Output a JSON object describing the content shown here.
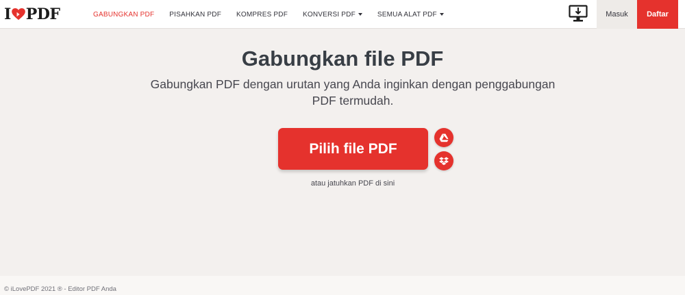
{
  "header": {
    "logo": {
      "prefix": "I",
      "suffix": "PDF",
      "heart_color": "#e5322d"
    },
    "nav": [
      {
        "label": "GABUNGKAN PDF",
        "active": true
      },
      {
        "label": "PISAHKAN PDF",
        "active": false
      },
      {
        "label": "KOMPRES PDF",
        "active": false
      },
      {
        "label": "KONVERSI PDF",
        "active": false,
        "dropdown": true
      },
      {
        "label": "SEMUA ALAT PDF",
        "active": false,
        "dropdown": true
      }
    ],
    "desktop_icon": "desktop-download-icon",
    "login_label": "Masuk",
    "signup_label": "Daftar"
  },
  "main": {
    "title": "Gabungkan file PDF",
    "subtitle": "Gabungkan PDF dengan urutan yang Anda inginkan dengan penggabungan PDF termudah.",
    "select_button": "Pilih file PDF",
    "cloud_buttons": [
      "google-drive-icon",
      "dropbox-icon"
    ],
    "drop_hint": "atau jatuhkan PDF di sini"
  },
  "footer": {
    "text": "© iLovePDF 2021 ® - Editor PDF Anda"
  },
  "colors": {
    "accent": "#e5322d",
    "background": "#f3f0ee",
    "text_dark": "#383e45"
  }
}
